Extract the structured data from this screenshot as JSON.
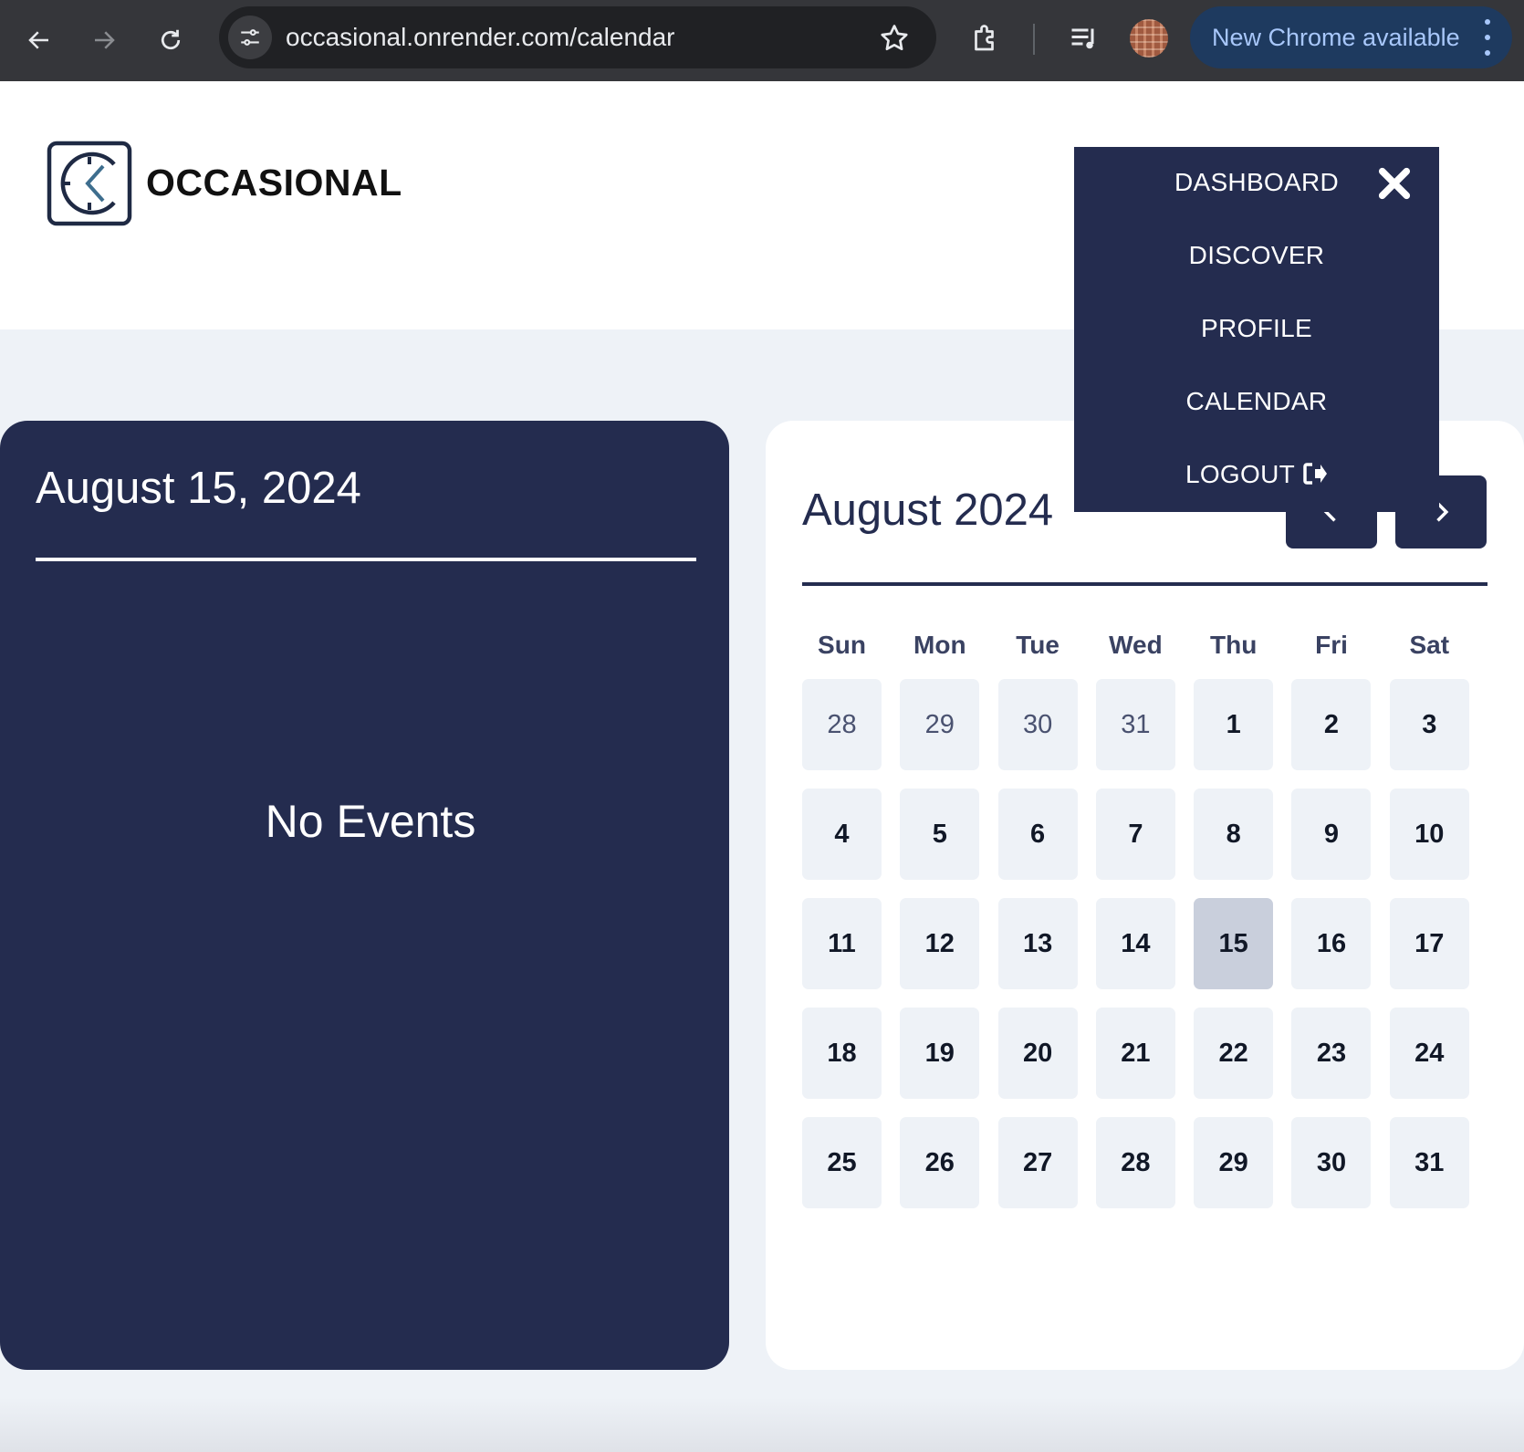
{
  "browser": {
    "url": "occasional.onrender.com/calendar",
    "update_label": "New Chrome available",
    "icons": [
      "back-arrow-icon",
      "forward-arrow-icon",
      "reload-icon",
      "site-settings-icon",
      "bookmark-star-icon",
      "extensions-icon",
      "media-controls-icon",
      "profile-avatar",
      "more-vert-icon"
    ]
  },
  "header": {
    "brand": "OCCASIONAL",
    "logo_icon": "clock-logo-icon"
  },
  "menu": {
    "items": [
      {
        "label": "DASHBOARD"
      },
      {
        "label": "DISCOVER"
      },
      {
        "label": "PROFILE"
      },
      {
        "label": "CALENDAR"
      },
      {
        "label": "LOGOUT"
      }
    ],
    "close_icon": "close-icon",
    "logout_icon": "sign-out-icon"
  },
  "events_panel": {
    "selected_date": "August 15, 2024",
    "empty_message": "No Events"
  },
  "calendar": {
    "month_label": "August 2024",
    "prev_icon": "chevron-left-icon",
    "next_icon": "chevron-right-icon",
    "weekdays": [
      "Sun",
      "Mon",
      "Tue",
      "Wed",
      "Thu",
      "Fri",
      "Sat"
    ],
    "days": [
      {
        "n": "28",
        "other": true
      },
      {
        "n": "29",
        "other": true
      },
      {
        "n": "30",
        "other": true
      },
      {
        "n": "31",
        "other": true
      },
      {
        "n": "1"
      },
      {
        "n": "2"
      },
      {
        "n": "3"
      },
      {
        "n": "4"
      },
      {
        "n": "5"
      },
      {
        "n": "6"
      },
      {
        "n": "7"
      },
      {
        "n": "8"
      },
      {
        "n": "9"
      },
      {
        "n": "10"
      },
      {
        "n": "11"
      },
      {
        "n": "12"
      },
      {
        "n": "13"
      },
      {
        "n": "14"
      },
      {
        "n": "15",
        "selected": true
      },
      {
        "n": "16"
      },
      {
        "n": "17"
      },
      {
        "n": "18"
      },
      {
        "n": "19"
      },
      {
        "n": "20"
      },
      {
        "n": "21"
      },
      {
        "n": "22"
      },
      {
        "n": "23"
      },
      {
        "n": "24"
      },
      {
        "n": "25"
      },
      {
        "n": "26"
      },
      {
        "n": "27"
      },
      {
        "n": "28"
      },
      {
        "n": "29"
      },
      {
        "n": "30"
      },
      {
        "n": "31"
      }
    ]
  },
  "colors": {
    "navy": "#242c4f",
    "page_bg": "#eef2f7",
    "selected_day": "#c9cfdc",
    "chrome_bar": "#35363a",
    "update_pill": "#1e3a5f"
  }
}
